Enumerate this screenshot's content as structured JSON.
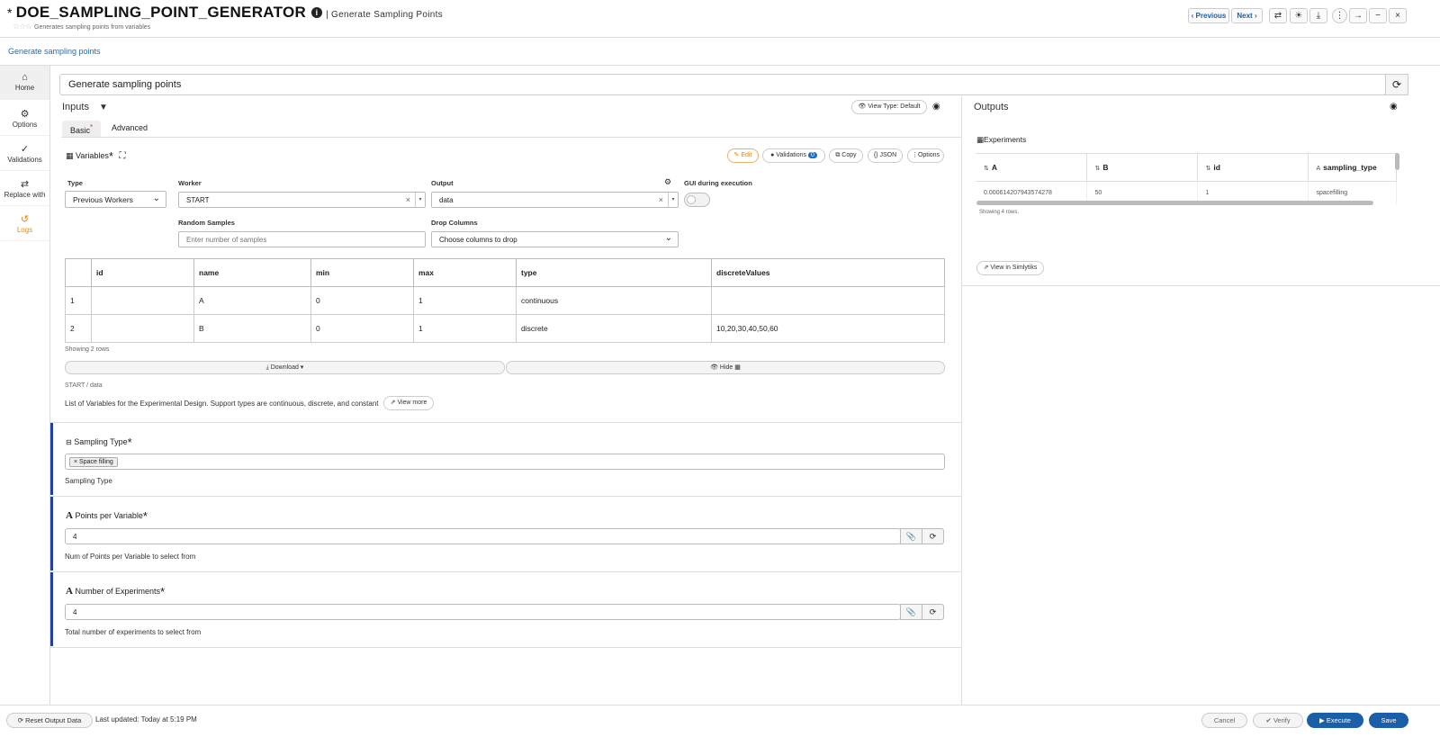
{
  "header": {
    "unsaved_marker": "*",
    "title": "DOE_SAMPLING_POINT_GENERATOR",
    "subtitle": "| Generate Sampling Points",
    "description": "Generates sampling points from variables",
    "previous_label": "Previous",
    "next_label": "Next"
  },
  "breadcrumb": "Generate sampling points",
  "sidebar": {
    "items": [
      {
        "label": "Home",
        "icon": "home-icon"
      },
      {
        "label": "Options",
        "icon": "gear-icon"
      },
      {
        "label": "Validations",
        "icon": "check-icon"
      },
      {
        "label": "Replace with",
        "icon": "swap-icon"
      },
      {
        "label": "Logs",
        "icon": "history-icon"
      }
    ]
  },
  "worker_name": "Generate sampling points",
  "inputs": {
    "title": "Inputs",
    "view_type_label": "View Type: Default",
    "tabs": [
      "Basic",
      "Advanced"
    ],
    "variables": {
      "title": "Variables",
      "toolbar": {
        "edit": "Edit",
        "validations": "Validations",
        "validations_count": "0",
        "copy": "Copy",
        "json": "{} JSON",
        "options": "Options"
      },
      "type_label": "Type",
      "type_value": "Previous Workers",
      "worker_label": "Worker",
      "worker_value": "START",
      "output_label": "Output",
      "output_value": "data",
      "gui_label": "GUI during execution",
      "random_label": "Random Samples",
      "random_placeholder": "Enter number of samples",
      "drop_label": "Drop Columns",
      "drop_placeholder": "Choose columns to drop",
      "columns": [
        "id",
        "name",
        "min",
        "max",
        "type",
        "discreteValues"
      ],
      "rows": [
        {
          "n": "1",
          "id": "",
          "name": "A",
          "min": "0",
          "max": "1",
          "type": "continuous",
          "discreteValues": ""
        },
        {
          "n": "2",
          "id": "",
          "name": "B",
          "min": "0",
          "max": "1",
          "type": "discrete",
          "discreteValues": "10,20,30,40,50,60"
        }
      ],
      "showing": "Showing 2 rows",
      "download_label": "Download",
      "hide_label": "Hide",
      "source_path": "START / data",
      "help": "List of Variables for the Experimental Design. Support types are continuous, discrete, and constant",
      "view_more": "View more"
    },
    "sampling_type": {
      "title": "Sampling Type",
      "tag": "Space filling",
      "help": "Sampling Type"
    },
    "points_per_variable": {
      "title": "Points per Variable",
      "value": "4",
      "help": "Num of Points per Variable to select from"
    },
    "number_of_experiments": {
      "title": "Number of Experiments",
      "value": "4",
      "help": "Total number of experiments to select from"
    }
  },
  "outputs": {
    "title": "Outputs",
    "experiments_title": "Experiments",
    "columns": [
      "A",
      "B",
      "id",
      "sampling_type"
    ],
    "row": [
      "0.000614207943574278",
      "50",
      "1",
      "spacefilling"
    ],
    "showing": "Showing 4 rows.",
    "view_in": "View in Simlytiks"
  },
  "footer": {
    "reset": "Reset Output Data",
    "last_updated": "Last updated: Today at 5:19 PM",
    "cancel": "Cancel",
    "verify": "Verify",
    "execute": "Execute",
    "save": "Save"
  },
  "colors": {
    "accent": "#1a5fa8",
    "card_bar": "#223fa8",
    "logs": "#e8890c"
  }
}
